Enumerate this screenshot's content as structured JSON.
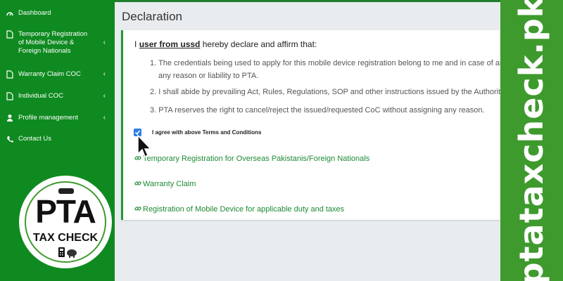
{
  "sidebar": {
    "items": [
      {
        "label": "Dashboard",
        "icon": "dashboard-icon",
        "caret": ""
      },
      {
        "label": "Temporary Registration of Mobile Device & Foreign Nationals",
        "icon": "file-icon",
        "caret": "‹"
      },
      {
        "label": "Warranty Claim COC",
        "icon": "file-icon",
        "caret": "‹"
      },
      {
        "label": "Individual COC",
        "icon": "file-icon",
        "caret": "‹"
      },
      {
        "label": "Profile management",
        "icon": "user-icon",
        "caret": "‹"
      },
      {
        "label": "Contact Us",
        "icon": "phone-icon",
        "caret": ""
      }
    ]
  },
  "logo": {
    "top_text": "PTA",
    "bottom_text": "TAX CHECK"
  },
  "page": {
    "title": "Declaration"
  },
  "declaration": {
    "prefix": "I",
    "user": "user from ussd",
    "suffix": "hereby declare and affirm that:",
    "points": [
      {
        "num": "1.",
        "line1": "The credentials being used to apply for this mobile device registration belong to me and in case of any misuse,",
        "line2": "any reason or liability to PTA."
      },
      {
        "num": "2.",
        "line1": "I shall abide by prevailing Act, Rules, Regulations, SOP and other instructions issued by the Authority from time to time."
      },
      {
        "num": "3.",
        "line1": "PTA reserves the right to cancel/reject the issued/requested CoC without assigning any reason."
      }
    ],
    "agree_label": "I agree with above Terms and Conditions",
    "agree_checked": true
  },
  "links": [
    {
      "label": "Temporary Registration for Overseas Pakistanis/Foreign Nationals"
    },
    {
      "label": "Warranty Claim"
    },
    {
      "label": "Registration of Mobile Device for applicable duty and taxes"
    }
  ],
  "banner": {
    "text": "ptataxcheck.pk"
  },
  "colors": {
    "sidebar": "#0f8a20",
    "accent": "#1e9a3a",
    "banner": "#3e9a2d",
    "link": "#1e8a33"
  }
}
